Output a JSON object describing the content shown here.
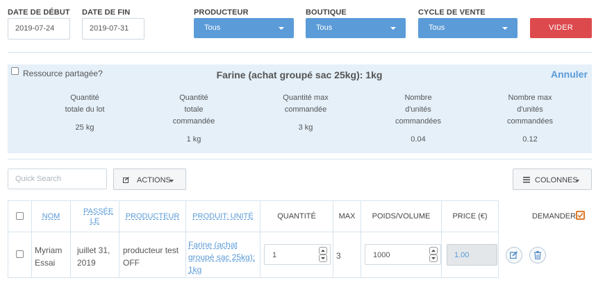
{
  "filters": {
    "date_debut": {
      "label": "DATE DE DÉBUT",
      "value": "2019-07-24"
    },
    "date_fin": {
      "label": "DATE DE FIN",
      "value": "2019-07-31"
    },
    "producteur": {
      "label": "PRODUCTEUR",
      "selected": "Tous"
    },
    "boutique": {
      "label": "BOUTIQUE",
      "selected": "Tous"
    },
    "cycle": {
      "label": "CYCLE DE VENTE",
      "selected": "Tous"
    },
    "vider_label": "VIDER"
  },
  "panel": {
    "shared_label": "Ressource partagée?",
    "title": "Farine (achat groupé sac 25kg): 1kg",
    "cancel_label": "Annuler",
    "stats": [
      {
        "label": "Quantité\ntotale du lot",
        "value": "25 kg"
      },
      {
        "label": "Quantité\ntotale\ncommandée",
        "value": "1 kg"
      },
      {
        "label": "Quantité max\ncommandée",
        "value": "3 kg"
      },
      {
        "label": "Nombre\nd'unités\ncommandées",
        "value": "0.04"
      },
      {
        "label": "Nombre max\nd'unités\ncommandées",
        "value": "0.12"
      }
    ]
  },
  "toolbar": {
    "search_placeholder": "Quick Search",
    "actions_label": "ACTIONS",
    "columns_label": "COLONNES"
  },
  "table": {
    "headers": {
      "nom": "NOM",
      "passee_le": "PASSÉE LE",
      "producteur": "PRODUCTEUR",
      "produit": "PRODUIT: UNITÉ",
      "quantite": "QUANTITÉ",
      "max": "MAX",
      "poids": "POIDS/VOLUME",
      "price": "PRICE (€)",
      "demander": "DEMANDER?"
    },
    "rows": [
      {
        "nom": "Myriam Essai",
        "passee_le": "juillet 31, 2019",
        "producteur": "producteur test OFF",
        "produit": "Farine (achat groupé sac 25kg): 1kg",
        "quantite": "1",
        "max": "3",
        "poids": "1000",
        "price": "1.00"
      }
    ]
  },
  "colors": {
    "accent_blue": "#5b9bd8",
    "danger_red": "#dd4a4d",
    "panel_bg": "#e5f0f9",
    "checkbox_orange": "#e07b2a"
  }
}
